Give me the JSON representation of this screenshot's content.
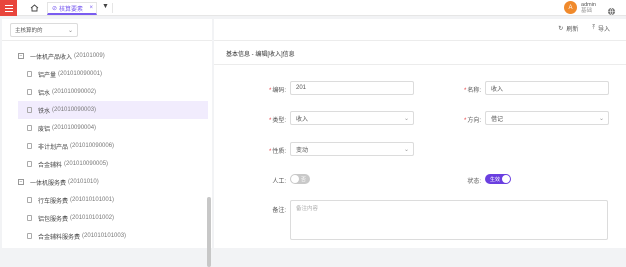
{
  "topbar": {
    "tab_label": "核算要素",
    "user_name": "admin",
    "user_sub": "基础"
  },
  "left": {
    "account_select": "主核算的的",
    "tree": [
      {
        "type": "group",
        "label": "一体机产品收入",
        "code": "(20101009)",
        "toggle": "−"
      },
      {
        "type": "leaf",
        "label": "铝产量",
        "code": "(201010090001)"
      },
      {
        "type": "leaf",
        "label": "铝水",
        "code": "(201010090002)"
      },
      {
        "type": "leaf",
        "label": "铁水",
        "code": "(201010090003)",
        "selected": true
      },
      {
        "type": "leaf",
        "label": "废铝",
        "code": "(201010090004)"
      },
      {
        "type": "leaf",
        "label": "非计划产品",
        "code": "(201010090006)"
      },
      {
        "type": "leaf",
        "label": "合金辅料",
        "code": "(201010090005)"
      },
      {
        "type": "group",
        "label": "一体机服务费",
        "code": "(20101010)",
        "toggle": "−"
      },
      {
        "type": "leaf",
        "label": "行车服务费",
        "code": "(201010101001)"
      },
      {
        "type": "leaf",
        "label": "铝包服务费",
        "code": "(201010101002)"
      },
      {
        "type": "leaf",
        "label": "合金辅料服务费",
        "code": "(201010101003)"
      }
    ]
  },
  "right": {
    "refresh_label": "刷新",
    "import_label": "导入",
    "section_title": "基本信息 - 编辑[收入]信息",
    "fields": {
      "code_label": "编码:",
      "code_value": "201",
      "name_label": "名称:",
      "name_value": "收入",
      "type_label": "类型:",
      "type_value": "收入",
      "direction_label": "方向:",
      "direction_value": "借记",
      "nature_label": "性质:",
      "nature_value": "变动",
      "manual_label": "人工:",
      "manual_switch": "否",
      "status_label": "状态:",
      "status_switch": "生效",
      "remark_label": "备注:",
      "remark_placeholder": "备注内容"
    }
  },
  "colors": {
    "accent": "#6a3fe0",
    "menu": "#e8453c",
    "avatar": "#f08a2c"
  }
}
